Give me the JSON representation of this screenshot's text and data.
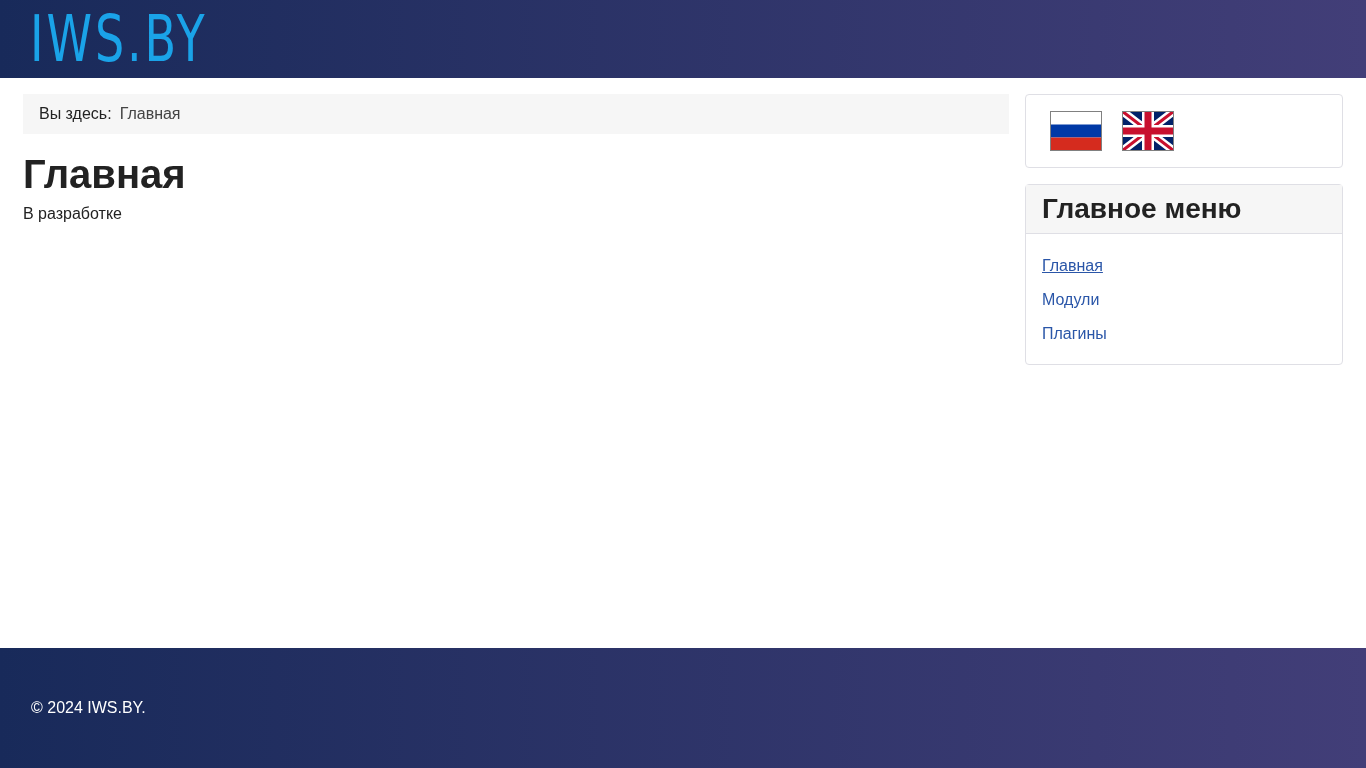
{
  "header": {
    "logo": "IWS.BY"
  },
  "breadcrumb": {
    "label": "Вы здесь:",
    "items": [
      "Главная"
    ]
  },
  "article": {
    "title": "Главная",
    "text": "В разработке"
  },
  "languages": [
    {
      "kind": "ru"
    },
    {
      "kind": "gb"
    }
  ],
  "main_menu": {
    "title": "Главное меню",
    "items": [
      {
        "label": "Главная",
        "selected": true
      },
      {
        "label": "Модули",
        "selected": false
      },
      {
        "label": "Плагины",
        "selected": false
      }
    ]
  },
  "footer": {
    "text": "© 2024 IWS.BY."
  }
}
